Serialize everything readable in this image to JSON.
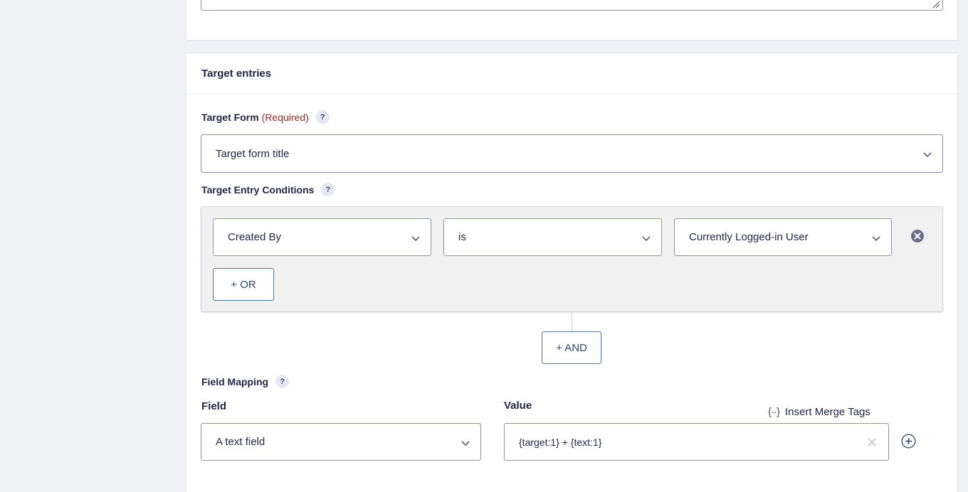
{
  "target_entries": {
    "section_title": "Target entries",
    "target_form": {
      "label": "Target Form",
      "required_text": "(Required)",
      "help": "?",
      "selected": "Target form title"
    },
    "conditions": {
      "label": "Target Entry Conditions",
      "help": "?",
      "rule": {
        "field": "Created By",
        "operator": "is",
        "value": "Currently Logged-in User"
      },
      "or_button": "+ OR",
      "and_button": "+ AND"
    },
    "field_mapping": {
      "label": "Field Mapping",
      "help": "?",
      "field_header": "Field",
      "value_header": "Value",
      "merge_tags_icon": "{··}",
      "merge_tags_label": "Insert Merge Tags",
      "row": {
        "field": "A text field",
        "value": "{target:1} + {text:1}"
      }
    }
  },
  "icons": {
    "chevron": "chevron-down-icon",
    "remove": "remove-circle-icon",
    "clear": "clear-x-icon",
    "add": "add-circle-icon",
    "resize": "resize-grip-icon"
  },
  "colors": {
    "required": "#9b2c2c",
    "button_border": "#56749a",
    "input_border": "#9092b2",
    "conditions_bg": "#f1f1f1"
  }
}
